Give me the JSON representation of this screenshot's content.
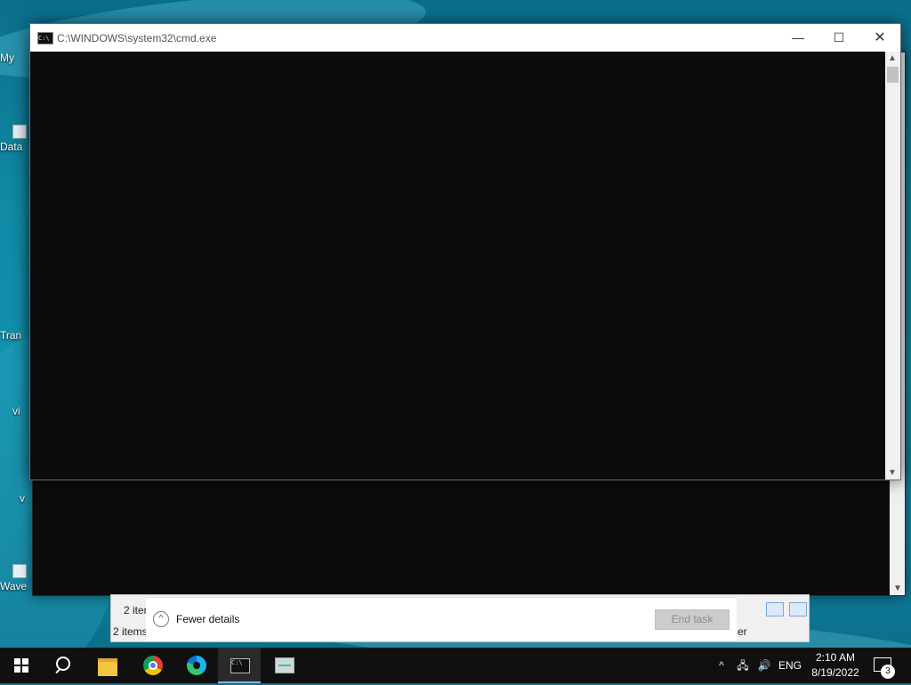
{
  "desktop": {
    "icons": [
      "My",
      "Data",
      "Tran",
      "vi",
      "v",
      "Wave"
    ]
  },
  "cmd_window": {
    "title": "C:\\WINDOWS\\system32\\cmd.exe",
    "minimize_glyph": "—",
    "maximize_glyph": "☐",
    "close_glyph": "✕",
    "scroll_up": "▲",
    "scroll_down": "▼"
  },
  "task_manager": {
    "items_count_1": "2 item",
    "items_count_2": "2 items",
    "right_text": "er",
    "fewer_details_label": "Fewer details",
    "fewer_glyph": "^",
    "end_task_label": "End task"
  },
  "taskbar": {
    "apps": [
      "start",
      "search",
      "file-explorer",
      "chrome",
      "edge",
      "cmd",
      "task-manager"
    ],
    "active_app": "cmd",
    "tray_chevron": "^",
    "language": "ENG",
    "time": "2:10 AM",
    "date": "8/19/2022",
    "notification_count": "3"
  }
}
